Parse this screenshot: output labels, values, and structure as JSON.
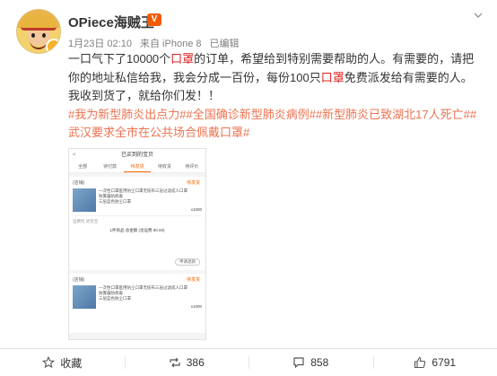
{
  "colors": {
    "accent_red": "#e02020",
    "hashtag": "#eb7350",
    "username": "#333333",
    "meta_gray": "#808080",
    "vip_orange": "#f05a00"
  },
  "post": {
    "username": "OPiece海贼王",
    "vip_badge": "V",
    "meta": {
      "date": "1月23日 02:10",
      "source": "来自 iPhone 8",
      "edited": "已编辑"
    },
    "body": {
      "p1a": "一口气下了10000个",
      "p1b": "口罩",
      "p1c": "的订单，希望给到特别需要帮助的人。有需要的，请把你的地址私信给我，我会分成一百份，每份100只",
      "p1d": "口罩",
      "p1e": "免费派发给有需要的人。我收到货了，就给你们发！！"
    },
    "hashtags": [
      "#我为新型肺炎出点力#",
      "#全国确诊新型肺炎病例#",
      "#新型肺炎已致湖北17人死亡#",
      "#武汉要求全市在公共场合佩戴口罩#"
    ]
  },
  "screenshot": {
    "header": "已买到的宝贝",
    "back": "<",
    "tabs": [
      "全部",
      "待付款",
      "待发货",
      "待收货",
      "待评价"
    ],
    "status": "待发货",
    "shop": "(店铺)",
    "product_title": "一次性口罩医用防尘口罩无纺布三层过滤成人口罩防雾霾防病毒",
    "product_sub": "三层蓝色防尘口罩",
    "qty": "x1000",
    "service_line": "运费险 退货宝",
    "total": "1件商品 总金额 (含运费 ¥0.00)",
    "btn": "申请退款",
    "qty2": "x1000"
  },
  "actions": {
    "favorite": {
      "icon": "star-icon",
      "label": "收藏"
    },
    "repost": {
      "icon": "repost-icon",
      "label": "386"
    },
    "comment": {
      "icon": "comment-icon",
      "label": "858"
    },
    "like": {
      "icon": "thumbs-up-icon",
      "label": "6791"
    }
  }
}
